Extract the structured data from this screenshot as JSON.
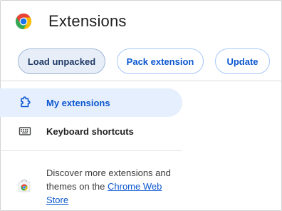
{
  "header": {
    "title": "Extensions",
    "logo_icon": "chrome-logo-icon"
  },
  "toolbar": {
    "load_unpacked": "Load unpacked",
    "pack_extension": "Pack extension",
    "update": "Update"
  },
  "nav": {
    "items": [
      {
        "label": "My extensions",
        "icon": "puzzle-piece-icon",
        "selected": true
      },
      {
        "label": "Keyboard shortcuts",
        "icon": "keyboard-icon",
        "selected": false
      }
    ]
  },
  "store": {
    "text_prefix": "Discover more extensions and themes on the ",
    "link_text": "Chrome Web Store",
    "icon": "chrome-web-store-icon"
  },
  "colors": {
    "accent": "#0b57d0",
    "selected_bg": "#e6effd",
    "button_border": "#a8c7fa"
  }
}
